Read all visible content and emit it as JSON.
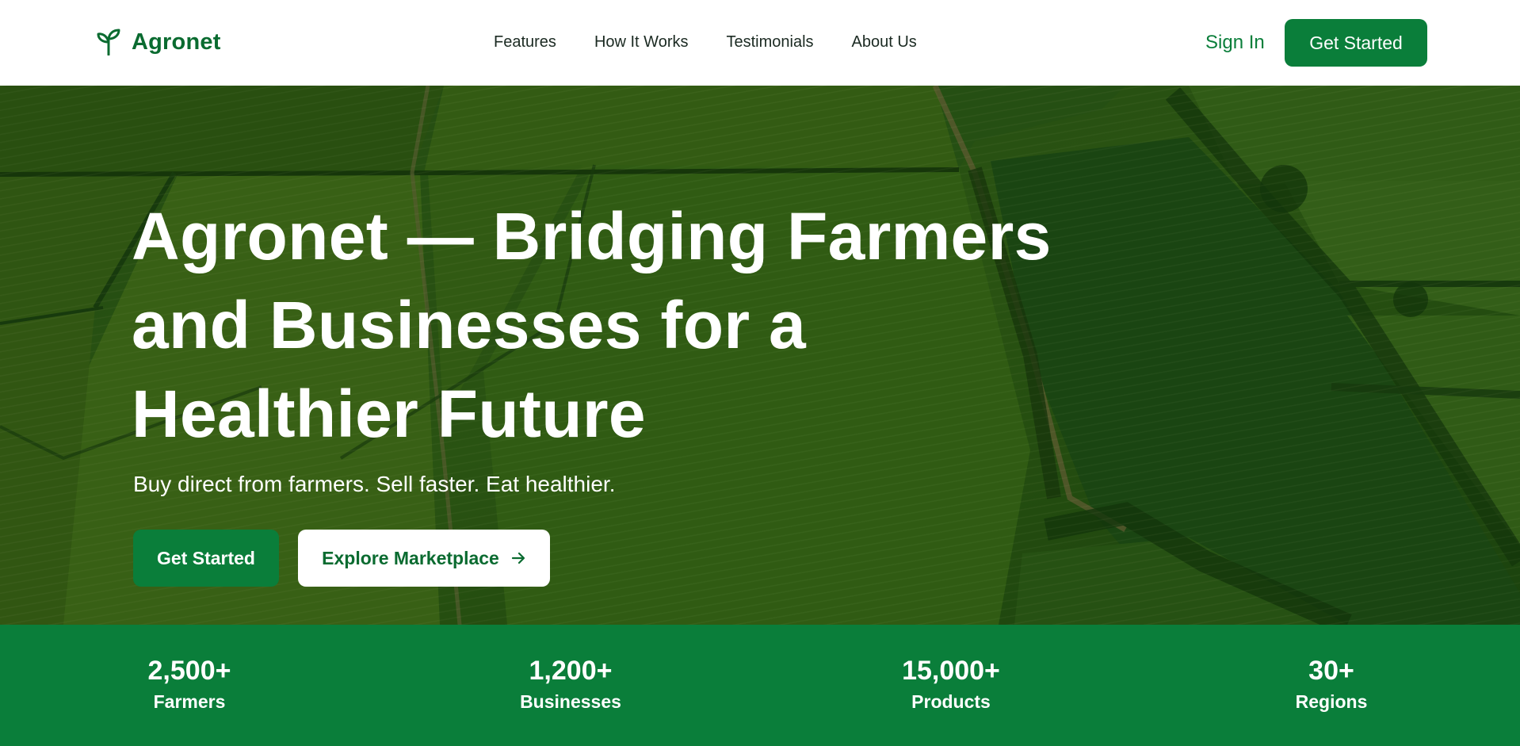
{
  "brand": {
    "name": "Agronet",
    "icon": "sprout-icon",
    "color": "#0a6b30"
  },
  "nav": {
    "links": [
      "Features",
      "How It Works",
      "Testimonials",
      "About Us"
    ],
    "sign_in": "Sign In",
    "cta": "Get Started"
  },
  "hero": {
    "title": "Agronet — Bridging Farmers and Businesses for a Healthier Future",
    "subtitle": "Buy direct from farmers. Sell faster. Eat healthier.",
    "primary_button": "Get Started",
    "secondary_button": "Explore Marketplace",
    "secondary_icon": "arrow-right-icon",
    "background": "aerial-farmland-image"
  },
  "stats": [
    {
      "value": "2,500+",
      "label": "Farmers"
    },
    {
      "value": "1,200+",
      "label": "Businesses"
    },
    {
      "value": "15,000+",
      "label": "Products"
    },
    {
      "value": "30+",
      "label": "Regions"
    }
  ],
  "colors": {
    "accent": "#0a7e3a",
    "nav_text": "#1b2a22",
    "white": "#ffffff"
  }
}
